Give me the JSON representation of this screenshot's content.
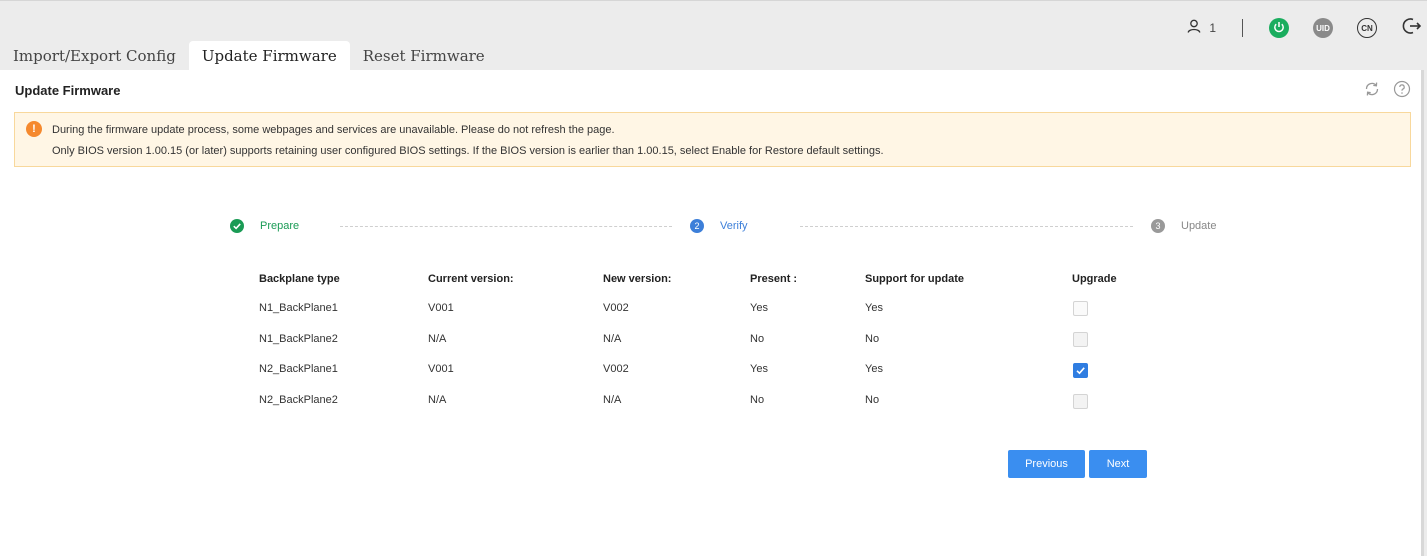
{
  "header": {
    "user_count": "1",
    "uid_label": "UID",
    "lang_label": "CN",
    "icons": [
      "user-icon",
      "power-icon",
      "uid-icon",
      "language-icon",
      "logout-icon"
    ],
    "colors": {
      "power": "#1aad5e",
      "uid": "#8a8a8a"
    }
  },
  "tabs": [
    {
      "label": "Import/Export Config",
      "active": false
    },
    {
      "label": "Update Firmware",
      "active": true
    },
    {
      "label": "Reset Firmware",
      "active": false
    }
  ],
  "panel": {
    "title": "Update Firmware",
    "icons": [
      "refresh-icon",
      "help-icon"
    ]
  },
  "notice": {
    "icon": "!",
    "line1": "During the firmware update process, some webpages and services are unavailable. Please do not refresh the page.",
    "line2": "Only BIOS version 1.00.15 (or later) supports retaining user configured BIOS settings. If the BIOS version is earlier than 1.00.15, select Enable for Restore default settings."
  },
  "steps": [
    {
      "number": "",
      "label": "Prepare",
      "state": "done"
    },
    {
      "number": "2",
      "label": "Verify",
      "state": "active"
    },
    {
      "number": "3",
      "label": "Update",
      "state": "pending"
    }
  ],
  "table": {
    "headers": [
      "Backplane type",
      "Current version:",
      "New version:",
      "Present :",
      "Support for update",
      "Upgrade"
    ],
    "rows": [
      {
        "type": "N1_BackPlane1",
        "current": "V001",
        "new": "V002",
        "present": "Yes",
        "support": "Yes",
        "upgrade": false,
        "enabled": true
      },
      {
        "type": "N1_BackPlane2",
        "current": "N/A",
        "new": "N/A",
        "present": "No",
        "support": "No",
        "upgrade": false,
        "enabled": false
      },
      {
        "type": "N2_BackPlane1",
        "current": "V001",
        "new": "V002",
        "present": "Yes",
        "support": "Yes",
        "upgrade": true,
        "enabled": true
      },
      {
        "type": "N2_BackPlane2",
        "current": "N/A",
        "new": "N/A",
        "present": "No",
        "support": "No",
        "upgrade": false,
        "enabled": false
      }
    ]
  },
  "buttons": {
    "previous": "Previous",
    "next": "Next"
  }
}
